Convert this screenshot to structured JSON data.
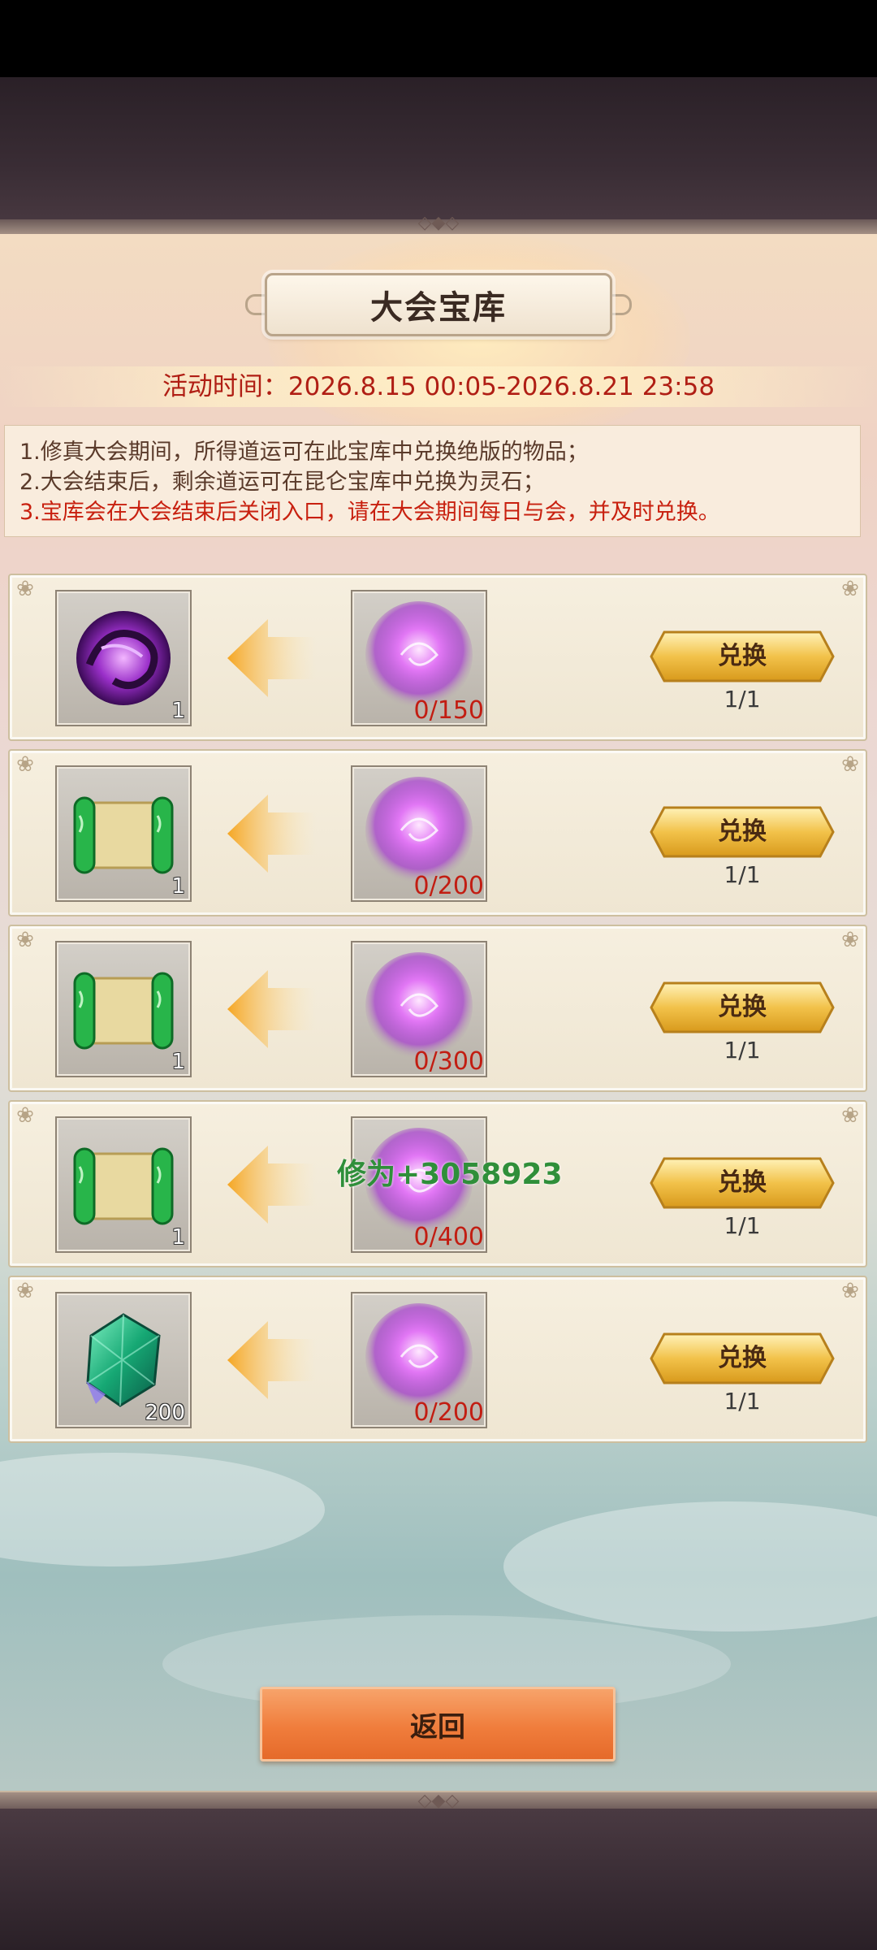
{
  "header": {
    "title": "大会宝库"
  },
  "event_time": "活动时间：2026.8.15 00:05-2026.8.21 23:58",
  "notes": [
    "1.修真大会期间，所得道运可在此宝库中兑换绝版的物品；",
    "2.大会结束后，剩余道运可在昆仑宝库中兑换为灵石；",
    "3.宝库会在大会结束后关闭入口，请在大会期间每日与会，并及时兑换。"
  ],
  "colors": {
    "accent_red": "#c21d12",
    "button_gold": "#f2c24a",
    "back_orange": "#f07d3c",
    "float_green": "#2f8f3a"
  },
  "rows": [
    {
      "reward_icon": "purple-dragon-orb-icon",
      "reward_count": "1",
      "cost_icon": "purple-spirit-orb-icon",
      "cost": "0/150",
      "button_label": "兑换",
      "limit": "1/1"
    },
    {
      "reward_icon": "green-scroll-icon",
      "reward_count": "1",
      "cost_icon": "purple-spirit-orb-icon",
      "cost": "0/200",
      "button_label": "兑换",
      "limit": "1/1"
    },
    {
      "reward_icon": "green-scroll-icon",
      "reward_count": "1",
      "cost_icon": "purple-spirit-orb-icon",
      "cost": "0/300",
      "button_label": "兑换",
      "limit": "1/1"
    },
    {
      "reward_icon": "green-scroll-icon",
      "reward_count": "1",
      "cost_icon": "purple-spirit-orb-icon",
      "cost": "0/400",
      "button_label": "兑换",
      "limit": "1/1"
    },
    {
      "reward_icon": "green-crystal-icon",
      "reward_count": "200",
      "cost_icon": "purple-spirit-orb-icon",
      "cost": "0/200",
      "button_label": "兑换",
      "limit": "1/1"
    }
  ],
  "floating_text": "修为+3058923",
  "back_button": {
    "label": "返回"
  }
}
